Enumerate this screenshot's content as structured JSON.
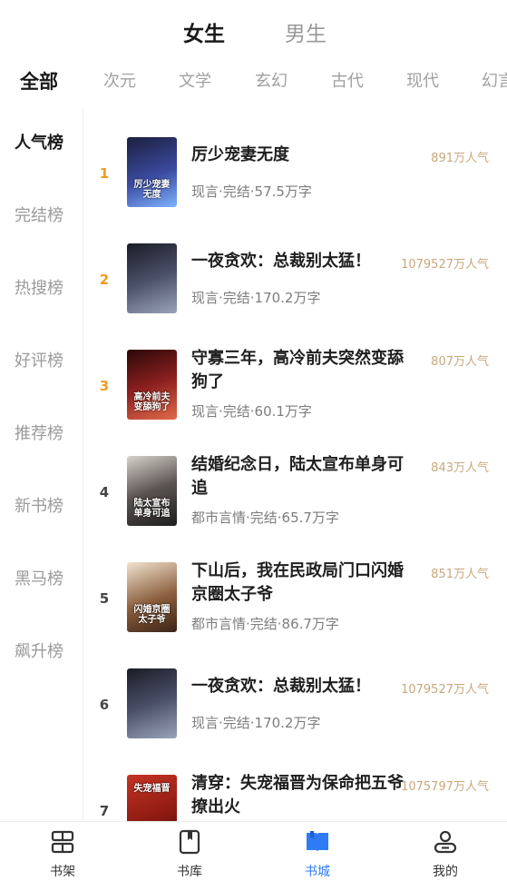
{
  "gender_tabs": {
    "active": "女生",
    "inactive": "男生"
  },
  "categories": [
    {
      "label": "全部",
      "active": true
    },
    {
      "label": "次元",
      "active": false
    },
    {
      "label": "文学",
      "active": false
    },
    {
      "label": "玄幻",
      "active": false
    },
    {
      "label": "古代",
      "active": false
    },
    {
      "label": "现代",
      "active": false
    },
    {
      "label": "幻言",
      "active": false
    }
  ],
  "sidebar": {
    "items": [
      {
        "label": "人气榜",
        "active": true
      },
      {
        "label": "完结榜",
        "active": false
      },
      {
        "label": "热搜榜",
        "active": false
      },
      {
        "label": "好评榜",
        "active": false
      },
      {
        "label": "推荐榜",
        "active": false
      },
      {
        "label": "新书榜",
        "active": false
      },
      {
        "label": "黑马榜",
        "active": false
      },
      {
        "label": "飙升榜",
        "active": false
      }
    ]
  },
  "books": [
    {
      "rank": "1",
      "title": "厉少宠妻无度",
      "meta": "现言·完结·57.5万字",
      "popularity": "891万人气",
      "cover_text": "厉少宠妻无度",
      "cover_color": "#2b3a78"
    },
    {
      "rank": "2",
      "title": "一夜贪欢：总裁别太猛！",
      "meta": "现言·完结·170.2万字",
      "popularity": "1079527万人气",
      "cover_text": "",
      "cover_color": "#3b3f52"
    },
    {
      "rank": "3",
      "title": "守寡三年，高冷前夫突然变舔狗了",
      "meta": "现言·完结·60.1万字",
      "popularity": "807万人气",
      "cover_text": "高冷前夫变舔狗了",
      "cover_color": "#7a1e1e"
    },
    {
      "rank": "4",
      "title": "结婚纪念日，陆太宣布单身可追",
      "meta": "都市言情·完结·65.7万字",
      "popularity": "843万人气",
      "cover_text": "陆太宣布单身可追",
      "cover_color": "#3a3a3a"
    },
    {
      "rank": "5",
      "title": "下山后，我在民政局门口闪婚京圈太子爷",
      "meta": "都市言情·完结·86.7万字",
      "popularity": "851万人气",
      "cover_text": "闪婚京圈太子爷",
      "cover_color": "#6e4b34"
    },
    {
      "rank": "6",
      "title": "一夜贪欢：总裁别太猛！",
      "meta": "现言·完结·170.2万字",
      "popularity": "1079527万人气",
      "cover_text": "",
      "cover_color": "#3b3f52"
    },
    {
      "rank": "7",
      "title": "清穿：失宠福晋为保命把五爷撩出火",
      "meta": "",
      "popularity": "1075797万人气",
      "cover_text": "失宠福晋",
      "cover_color": "#a82a1f"
    }
  ],
  "bottom_nav": [
    {
      "label": "书架",
      "icon": "bookshelf-icon",
      "active": false
    },
    {
      "label": "书库",
      "icon": "library-icon",
      "active": false
    },
    {
      "label": "书城",
      "icon": "bookstore-icon",
      "active": true
    },
    {
      "label": "我的",
      "icon": "profile-icon",
      "active": false
    }
  ],
  "colors": {
    "accent": "#2f7bf5",
    "rank_top": "#f39a1e",
    "popularity": "#c9a77c"
  }
}
